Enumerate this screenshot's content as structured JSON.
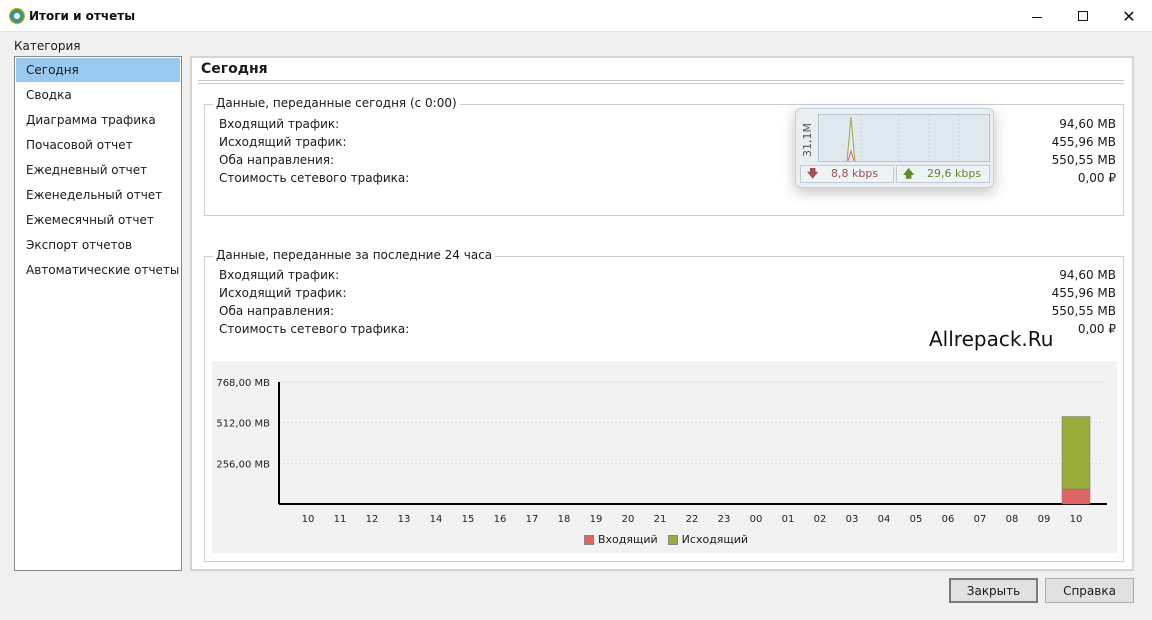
{
  "window": {
    "title": "Итоги и отчеты"
  },
  "sidebar": {
    "category_label": "Категория",
    "items": [
      {
        "label": "Сегодня"
      },
      {
        "label": "Сводка"
      },
      {
        "label": "Диаграмма трафика"
      },
      {
        "label": "Почасовой отчет"
      },
      {
        "label": "Ежедневный отчет"
      },
      {
        "label": "Еженедельный отчет"
      },
      {
        "label": "Ежемесячный отчет"
      },
      {
        "label": "Экспорт отчетов"
      },
      {
        "label": "Автоматические отчеты"
      }
    ],
    "selected_index": 0
  },
  "main": {
    "title": "Сегодня",
    "today_group": {
      "caption": "Данные, переданные сегодня (с 0:00)",
      "rows": [
        {
          "label": "Входящий трафик:",
          "value": "94,60 MB"
        },
        {
          "label": "Исходящий трафик:",
          "value": "455,96 MB"
        },
        {
          "label": "Оба направления:",
          "value": "550,55 MB"
        },
        {
          "label": "Стоимость сетевого трафика:",
          "value": "0,00 ₽"
        }
      ]
    },
    "last24_group": {
      "caption": "Данные, переданные за последние 24 часа",
      "rows": [
        {
          "label": "Входящий трафик:",
          "value": "94,60 MB"
        },
        {
          "label": "Исходящий трафик:",
          "value": "455,96 MB"
        },
        {
          "label": "Оба направления:",
          "value": "550,55 MB"
        },
        {
          "label": "Стоимость сетевого трафика:",
          "value": "0,00 ₽"
        }
      ]
    },
    "watermark": "Allrepack.Ru"
  },
  "widget": {
    "scale_label": "31,1M",
    "download_speed": "8,8 kbps",
    "upload_speed": "29,6 kbps"
  },
  "chart_data": {
    "type": "bar",
    "stacked": true,
    "categories": [
      "10",
      "11",
      "12",
      "13",
      "14",
      "15",
      "16",
      "17",
      "18",
      "19",
      "20",
      "21",
      "22",
      "23",
      "00",
      "01",
      "02",
      "03",
      "04",
      "05",
      "06",
      "07",
      "08",
      "09",
      "10"
    ],
    "y_ticks": [
      "768,00 MB",
      "512,00 MB",
      "256,00 MB"
    ],
    "y_tick_values": [
      768,
      512,
      256
    ],
    "ylim": [
      0,
      768
    ],
    "series": [
      {
        "name": "Входящий",
        "color": "#e06666",
        "values": [
          0,
          0,
          0,
          0,
          0,
          0,
          0,
          0,
          0,
          0,
          0,
          0,
          0,
          0,
          0,
          0,
          0,
          0,
          0,
          0,
          0,
          0,
          0,
          0,
          94.6
        ]
      },
      {
        "name": "Исходящий",
        "color": "#9aad3c",
        "values": [
          0,
          0,
          0,
          0,
          0,
          0,
          0,
          0,
          0,
          0,
          0,
          0,
          0,
          0,
          0,
          0,
          0,
          0,
          0,
          0,
          0,
          0,
          0,
          0,
          455.96
        ]
      }
    ],
    "grid": true,
    "legend_position": "bottom"
  },
  "buttons": {
    "close_label": "Закрыть",
    "help_label": "Справка"
  }
}
